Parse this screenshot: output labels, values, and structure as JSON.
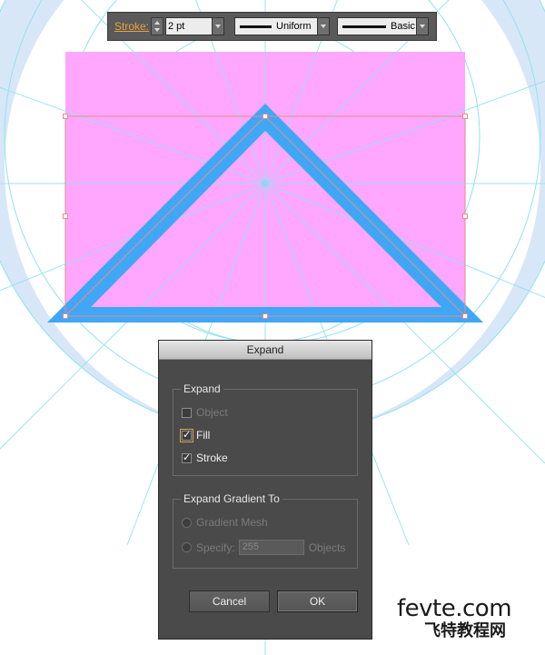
{
  "toolbar": {
    "stroke_label": "Stroke:",
    "weight_value": "2 pt",
    "profile_label": "Uniform",
    "brush_label": "Basic"
  },
  "dialog": {
    "title": "Expand",
    "expand_group": {
      "legend": "Expand",
      "object_label": "Object",
      "object_checked": false,
      "object_enabled": false,
      "fill_label": "Fill",
      "fill_checked": true,
      "stroke_label": "Stroke",
      "stroke_checked": true
    },
    "gradient_group": {
      "legend": "Expand Gradient To",
      "gradient_mesh_label": "Gradient Mesh",
      "specify_label": "Specify:",
      "specify_value": "255",
      "objects_label": "Objects"
    },
    "cancel_label": "Cancel",
    "ok_label": "OK"
  },
  "watermark": {
    "line1": "fevte.com",
    "line2": "飞特教程网"
  },
  "colors": {
    "artboard_fill": "#ffa6ff",
    "triangle_stroke": "#3fa7f5",
    "guide_line": "#8fe3f0",
    "ring_fill": "#d8e7f8",
    "selection": "#e88a8a",
    "fevte_accent": "#e23b2c"
  }
}
